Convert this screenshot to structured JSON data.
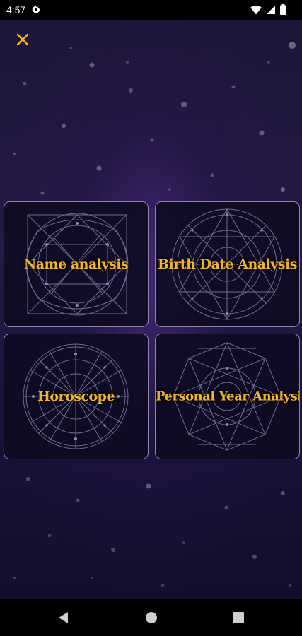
{
  "status_bar": {
    "time": "4:57",
    "icons": [
      "settings-gear-icon",
      "wifi-icon",
      "signal-icon",
      "battery-icon"
    ]
  },
  "header": {
    "close_icon": "close-icon",
    "accent_color": "#f2b52a"
  },
  "cards": [
    {
      "label": "Name analysis",
      "icon": "square-sigil-icon"
    },
    {
      "label": "Birth Date Analysis",
      "icon": "circle-mandala-icon"
    },
    {
      "label": "Horoscope",
      "icon": "zodiac-wheel-icon"
    },
    {
      "label": "Personal Year Analysis",
      "icon": "octagram-icon"
    }
  ],
  "nav_bar": {
    "back_icon": "back-triangle-icon",
    "home_icon": "home-circle-icon",
    "recents_icon": "recents-square-icon"
  },
  "colors": {
    "background": "#1f1740",
    "card_border": "#8b86a8",
    "label": "#f2b52a"
  }
}
